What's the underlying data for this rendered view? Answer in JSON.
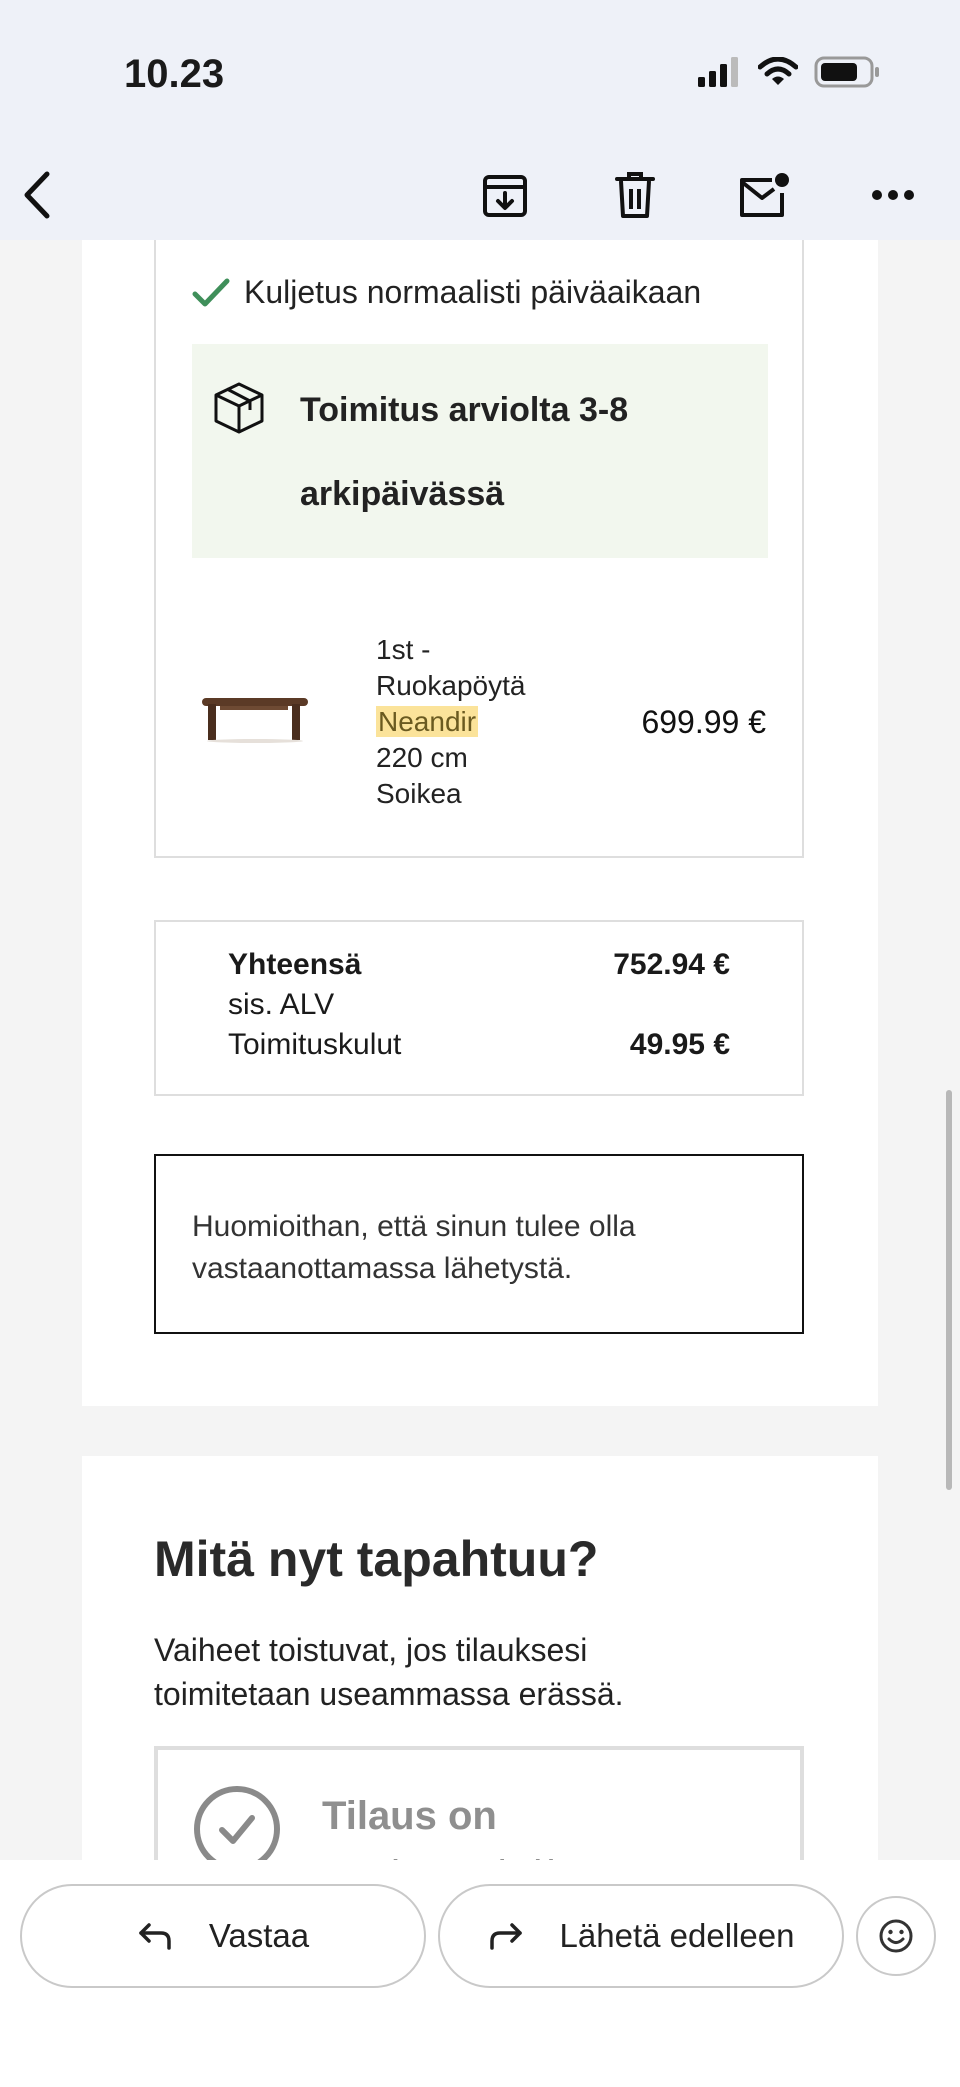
{
  "status_bar": {
    "time": "10.23"
  },
  "order": {
    "delivery_note": "Kuljetus normaalisti päiväaikaan",
    "delivery_estimate": "Toimitus arviolta 3-8 arkipäivässä",
    "product": {
      "line1": "1st -",
      "line2": "Ruokapöytä",
      "highlight": "Neandir",
      "line4": "220 cm",
      "line5": "Soikea",
      "price": "699.99 €"
    },
    "summary": {
      "total_label": "Yhteensä",
      "total_value": "752.94 €",
      "vat_label": "sis. ALV",
      "shipping_label": "Toimituskulut",
      "shipping_value": "49.95 €"
    },
    "notice": "Huomioithan, että sinun tulee olla vastaanottamassa lähetystä."
  },
  "next_steps": {
    "title": "Mitä nyt tapahtuu?",
    "intro": "Vaiheet toistuvat, jos tilauksesi toimitetaan useammassa erässä.",
    "step1": "Tilaus on vastaanotettu"
  },
  "actions": {
    "reply": "Vastaa",
    "forward": "Lähetä edelleen"
  },
  "colors": {
    "check_green": "#3f8f5a",
    "estimate_bg": "#f2f7ee",
    "highlight": "#fbe39a"
  }
}
